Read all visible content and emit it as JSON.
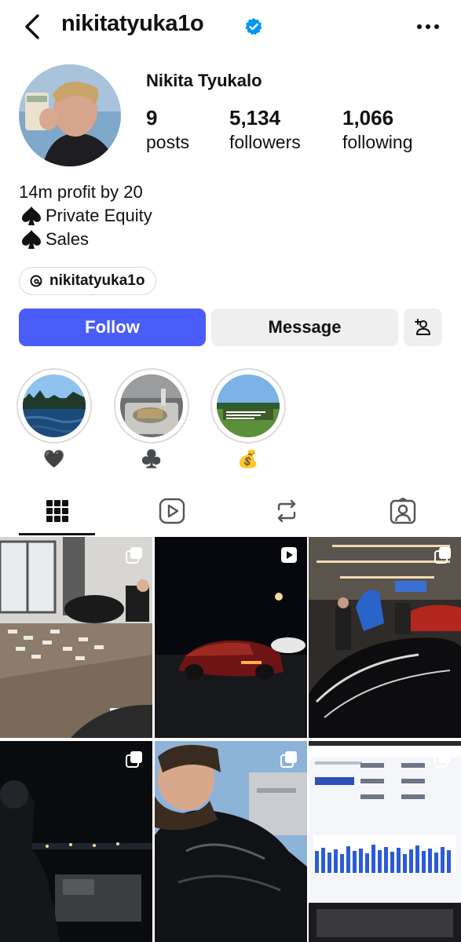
{
  "header": {
    "username": "nikitatyuka1o",
    "back_icon": "chevron-left-icon",
    "verified_icon": "verified-badge-icon",
    "more_icon": "more-horizontal-icon",
    "verified_color": "#0095f6"
  },
  "profile": {
    "display_name": "Nikita Tyukalo",
    "stats": [
      {
        "value": "9",
        "label": "posts"
      },
      {
        "value": "5,134",
        "label": "followers"
      },
      {
        "value": "1,066",
        "label": "following"
      }
    ],
    "bio": [
      {
        "prefix_icon": "",
        "text": "14m profit by 20"
      },
      {
        "prefix_icon": "spade-icon",
        "text": "Private Equity"
      },
      {
        "prefix_icon": "spade-icon",
        "text": "Sales"
      }
    ],
    "threads": {
      "icon": "threads-icon",
      "handle": "nikitatyuka1o"
    }
  },
  "actions": {
    "follow_label": "Follow",
    "message_label": "Message",
    "add_person_icon": "add-person-icon",
    "follow_color": "#4a5df9"
  },
  "highlights": [
    {
      "label": "🖤",
      "cover": "lake-water"
    },
    {
      "label": "♣️",
      "cover": "bathroom-sink"
    },
    {
      "label": "💰",
      "cover": "golf-course-text"
    }
  ],
  "tabs": [
    {
      "name": "posts-grid",
      "icon": "grid-icon",
      "active": true
    },
    {
      "name": "reels",
      "icon": "reels-play-icon",
      "active": false
    },
    {
      "name": "reposts",
      "icon": "repost-icon",
      "active": false
    },
    {
      "name": "tagged",
      "icon": "tagged-person-icon",
      "active": false
    }
  ],
  "posts": [
    {
      "type": "carousel",
      "badge_icon": "carousel-icon",
      "scene": "room with cash on floor"
    },
    {
      "type": "reel",
      "badge_icon": "reel-icon",
      "scene": "red sports car at night"
    },
    {
      "type": "carousel",
      "badge_icon": "carousel-icon",
      "scene": "black supercar in showroom"
    },
    {
      "type": "carousel",
      "badge_icon": "carousel-icon",
      "scene": "night view over water"
    },
    {
      "type": "carousel",
      "badge_icon": "carousel-icon",
      "scene": "selfie in puffer jacket"
    },
    {
      "type": "carousel",
      "badge_icon": "carousel-icon",
      "scene": "laptop sales dashboard"
    }
  ]
}
